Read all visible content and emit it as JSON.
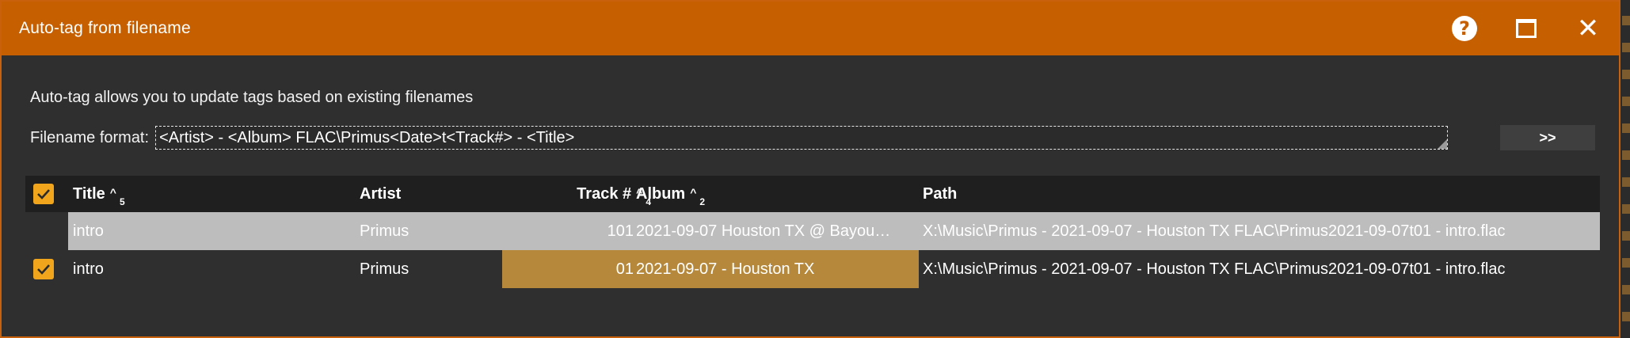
{
  "window": {
    "title": "Auto-tag from filename",
    "help_glyph": "?",
    "close_glyph": "✕"
  },
  "description": "Auto-tag allows you to update tags based on existing filenames",
  "format": {
    "label": "Filename format:",
    "value": "<Artist> - <Album> FLAC\\Primus<Date>t<Track#> - <Title>",
    "go_label": ">>"
  },
  "grid": {
    "columns": {
      "title": "Title",
      "title_sort": "^",
      "title_sort_order": "5",
      "artist": "Artist",
      "track": "Track #",
      "track_sort": "^",
      "track_sort_order": "4",
      "album": "Album",
      "album_sort": "^",
      "album_sort_order": "2",
      "path": "Path"
    },
    "header_checked": true,
    "rows": [
      {
        "checked": false,
        "title": "intro",
        "artist": "Primus",
        "track": "101",
        "album": "2021-09-07 Houston TX @ Bayou…",
        "path": "X:\\Music\\Primus - 2021-09-07 - Houston TX FLAC\\Primus2021-09-07t01 - intro.flac"
      },
      {
        "checked": true,
        "title": "intro",
        "artist": "Primus",
        "track": "01",
        "album": "2021-09-07 - Houston TX",
        "path": "X:\\Music\\Primus - 2021-09-07 - Houston TX FLAC\\Primus2021-09-07t01 - intro.flac"
      }
    ]
  },
  "colors": {
    "titlebar": "#c55f00",
    "checkbox": "#f0a51d",
    "selected_row": "#bdbdbd",
    "changed_cells": "#b5883c"
  },
  "icons": [
    "help-icon",
    "maximize-icon",
    "close-icon",
    "checkmark-icon"
  ]
}
